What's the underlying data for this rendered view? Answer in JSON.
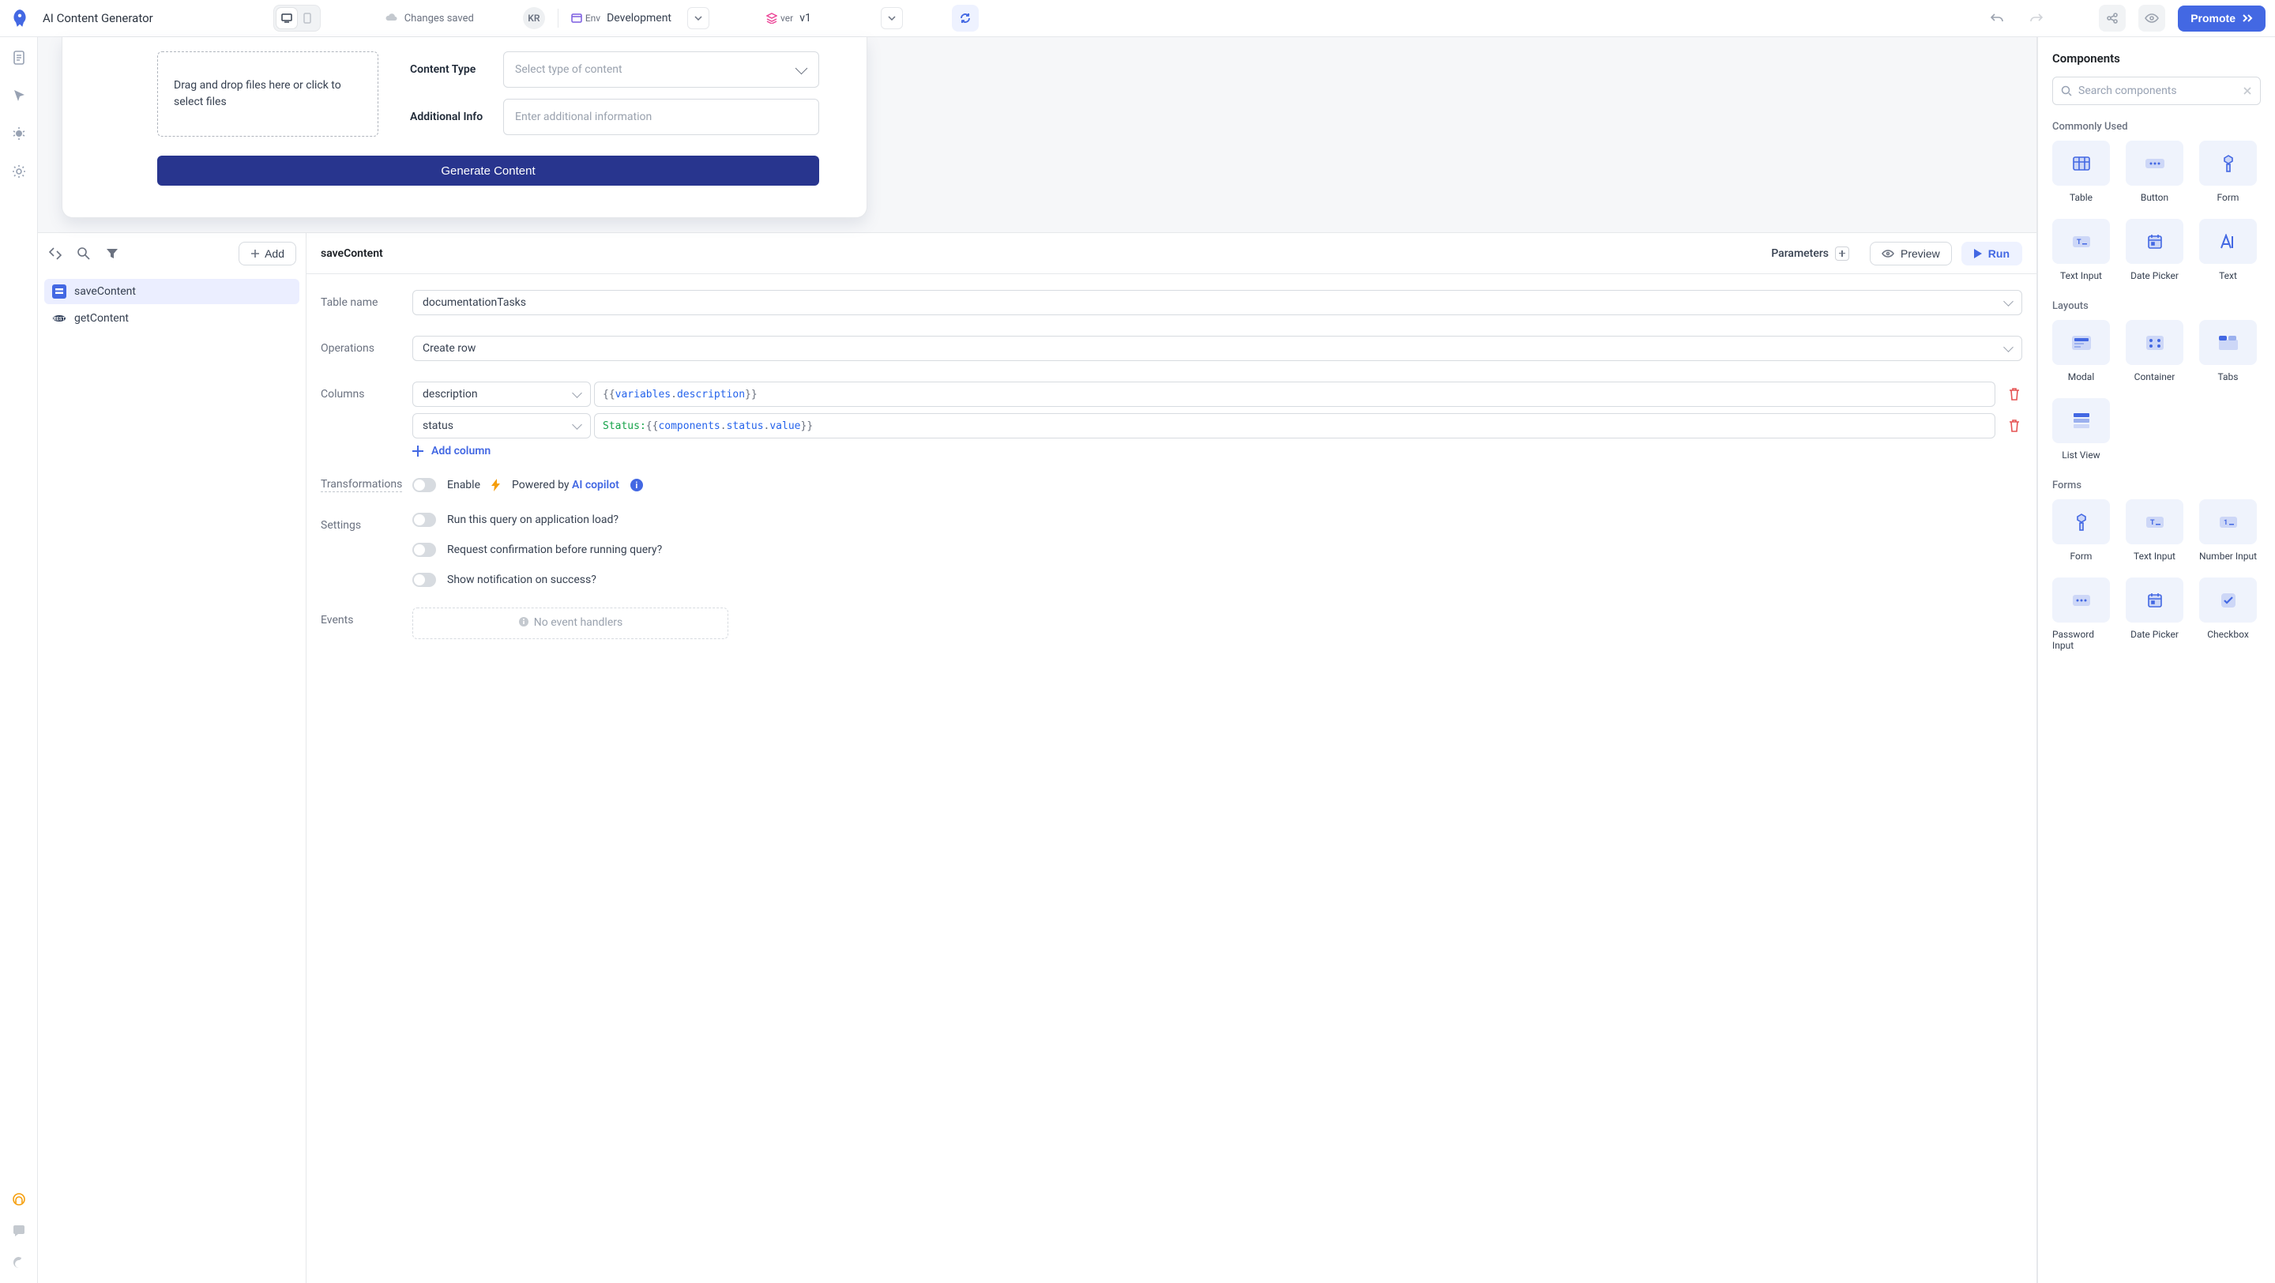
{
  "header": {
    "app_title": "AI Content Generator",
    "changes_saved": "Changes saved",
    "avatar": "KR",
    "env_label": "Env",
    "env_value": "Development",
    "ver_label": "ver",
    "ver_value": "v1",
    "promote": "Promote"
  },
  "canvas": {
    "dropzone": "Drag and drop files here or click to select files",
    "content_type_label": "Content Type",
    "content_type_placeholder": "Select type of content",
    "additional_info_label": "Additional Info",
    "additional_info_placeholder": "Enter additional information",
    "generate_button": "Generate Content"
  },
  "queriesSidebar": {
    "add": "Add",
    "items": [
      {
        "name": "saveContent",
        "icon": "tooljet-db"
      },
      {
        "name": "getContent",
        "icon": "runjs"
      }
    ]
  },
  "queryEditor": {
    "name": "saveContent",
    "parameters_label": "Parameters",
    "preview": "Preview",
    "run": "Run",
    "table_name_label": "Table name",
    "table_name_value": "documentationTasks",
    "operations_label": "Operations",
    "operations_value": "Create row",
    "columns_label": "Columns",
    "columns": [
      {
        "name": "description",
        "value_prefix": "{{",
        "value_mid1": "variables",
        "value_mid2": ".",
        "value_mid3": "description",
        "value_suffix": "}}"
      },
      {
        "name": "status",
        "value_literal": "Status: ",
        "value_prefix": "{{",
        "value_mid1": "components",
        "value_dot1": ".",
        "value_mid2": "status",
        "value_dot2": ".",
        "value_mid3": "value",
        "value_suffix": "}}"
      }
    ],
    "add_column": "Add column",
    "transformations_label": "Transformations",
    "enable_label": "Enable",
    "powered_by": "Powered by ",
    "ai_copilot": "AI copilot",
    "settings_label": "Settings",
    "settings": [
      "Run this query on application load?",
      "Request confirmation before running query?",
      "Show notification on success?"
    ],
    "events_label": "Events",
    "no_event_handlers": "No event handlers"
  },
  "componentsPanel": {
    "title": "Components",
    "search_placeholder": "Search components",
    "groups": [
      {
        "title": "Commonly Used",
        "items": [
          "Table",
          "Button",
          "Form",
          "Text Input",
          "Date Picker",
          "Text"
        ]
      },
      {
        "title": "Layouts",
        "items": [
          "Modal",
          "Container",
          "Tabs",
          "List View"
        ]
      },
      {
        "title": "Forms",
        "items": [
          "Form",
          "Text Input",
          "Number Input",
          "Password Input",
          "Date Picker",
          "Checkbox"
        ]
      }
    ]
  }
}
